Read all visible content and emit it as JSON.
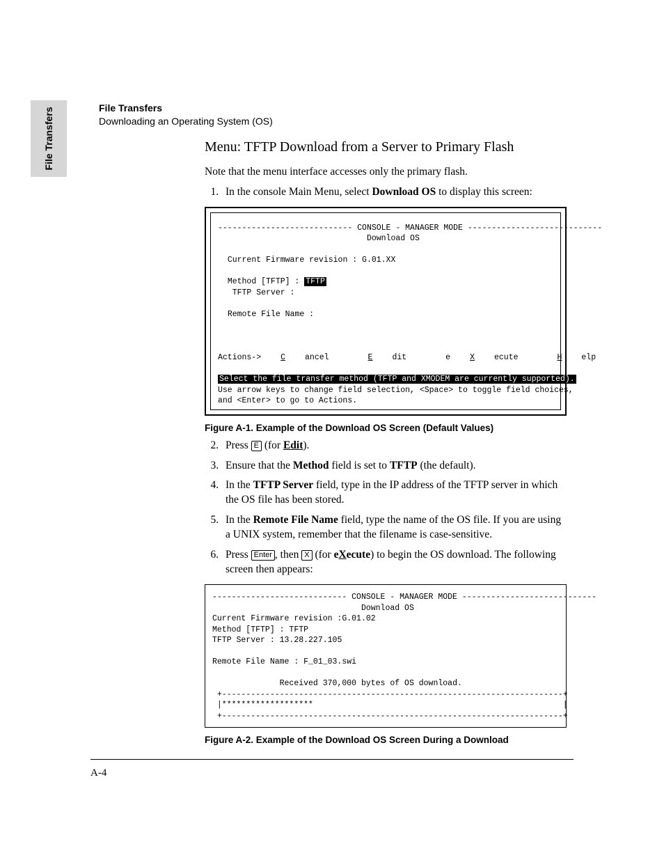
{
  "sideTab": "File Transfers",
  "runhead": {
    "l1": "File Transfers",
    "l2": "Downloading an Operating System (OS)"
  },
  "heading": "Menu: TFTP Download from a Server to Primary Flash",
  "intro": "Note that the menu interface accesses only the primary flash.",
  "step1_pre": "In the console Main Menu, select ",
  "step1_bold": "Download OS",
  "step1_post": "  to display this screen:",
  "term1": {
    "dash": "----------------------------",
    "title": " CONSOLE - MANAGER MODE ",
    "subtitle": "Download OS",
    "rev_label": "Current Firmware revision : ",
    "rev_val": "G.01.XX",
    "method_label": "Method [TFTP] : ",
    "method_val": "TFTP",
    "tftp_label": "TFTP Server :",
    "remote_label": "Remote File Name :",
    "actions_label": "Actions->",
    "menu": {
      "cancel": "Cancel",
      "edit": "Edit",
      "execute": "eXecute",
      "help": "Help"
    },
    "status": "Select the file transfer method (TFTP and XMODEM are currently supported).",
    "hint1": "Use arrow keys to change field selection, <Space> to toggle field choices,",
    "hint2": "and <Enter> to go to Actions."
  },
  "figA1": "Figure A-1.    Example of the Download OS Screen (Default Values)",
  "step2_pre": "Press ",
  "step2_key": "E",
  "step2_mid": " (for ",
  "step2_bold": "Edit",
  "step2_post": ").",
  "step3_pre": "Ensure that the  ",
  "step3_b1": "Method",
  "step3_mid": "  field is set to ",
  "step3_b2": "TFTP",
  "step3_post": " (the default).",
  "step4_pre": "In the ",
  "step4_b": "TFTP Server",
  "step4_post": " field, type in the IP address of the TFTP server in which the OS file has been stored.",
  "step5_pre": "In the  ",
  "step5_b": "Remote File Name",
  "step5_post": "  field, type the name of the OS file. If you are using a UNIX system, remember that the filename is case-sensitive.",
  "step6_pre": "Press ",
  "step6_k1": "Enter",
  "step6_mid1": ", then ",
  "step6_k2": "X",
  "step6_mid2": " (for ",
  "step6_b": "eXecute",
  "step6_post": ") to begin the OS download. The following screen then appears:",
  "term2": {
    "dash": "----------------------------",
    "title": " CONSOLE - MANAGER MODE ",
    "subtitle": "Download OS",
    "rev_label": "Current Firmware revision :",
    "rev_val": "G.01.02",
    "method_label": "Method [TFTP] : ",
    "method_val": "TFTP",
    "tftp_label": "TFTP Server : ",
    "tftp_val": "13.28.227.105",
    "remote_label": "Remote File Name : ",
    "remote_val": "F_01_03.swi",
    "received": "Received 370,000 bytes of OS download.",
    "edge": "+-----------------------------------------------------------------------+",
    "bar": "|*******************                                                    |"
  },
  "figA2": "Figure A-2.    Example of the Download OS Screen During a Download",
  "pageNum": "A-4"
}
